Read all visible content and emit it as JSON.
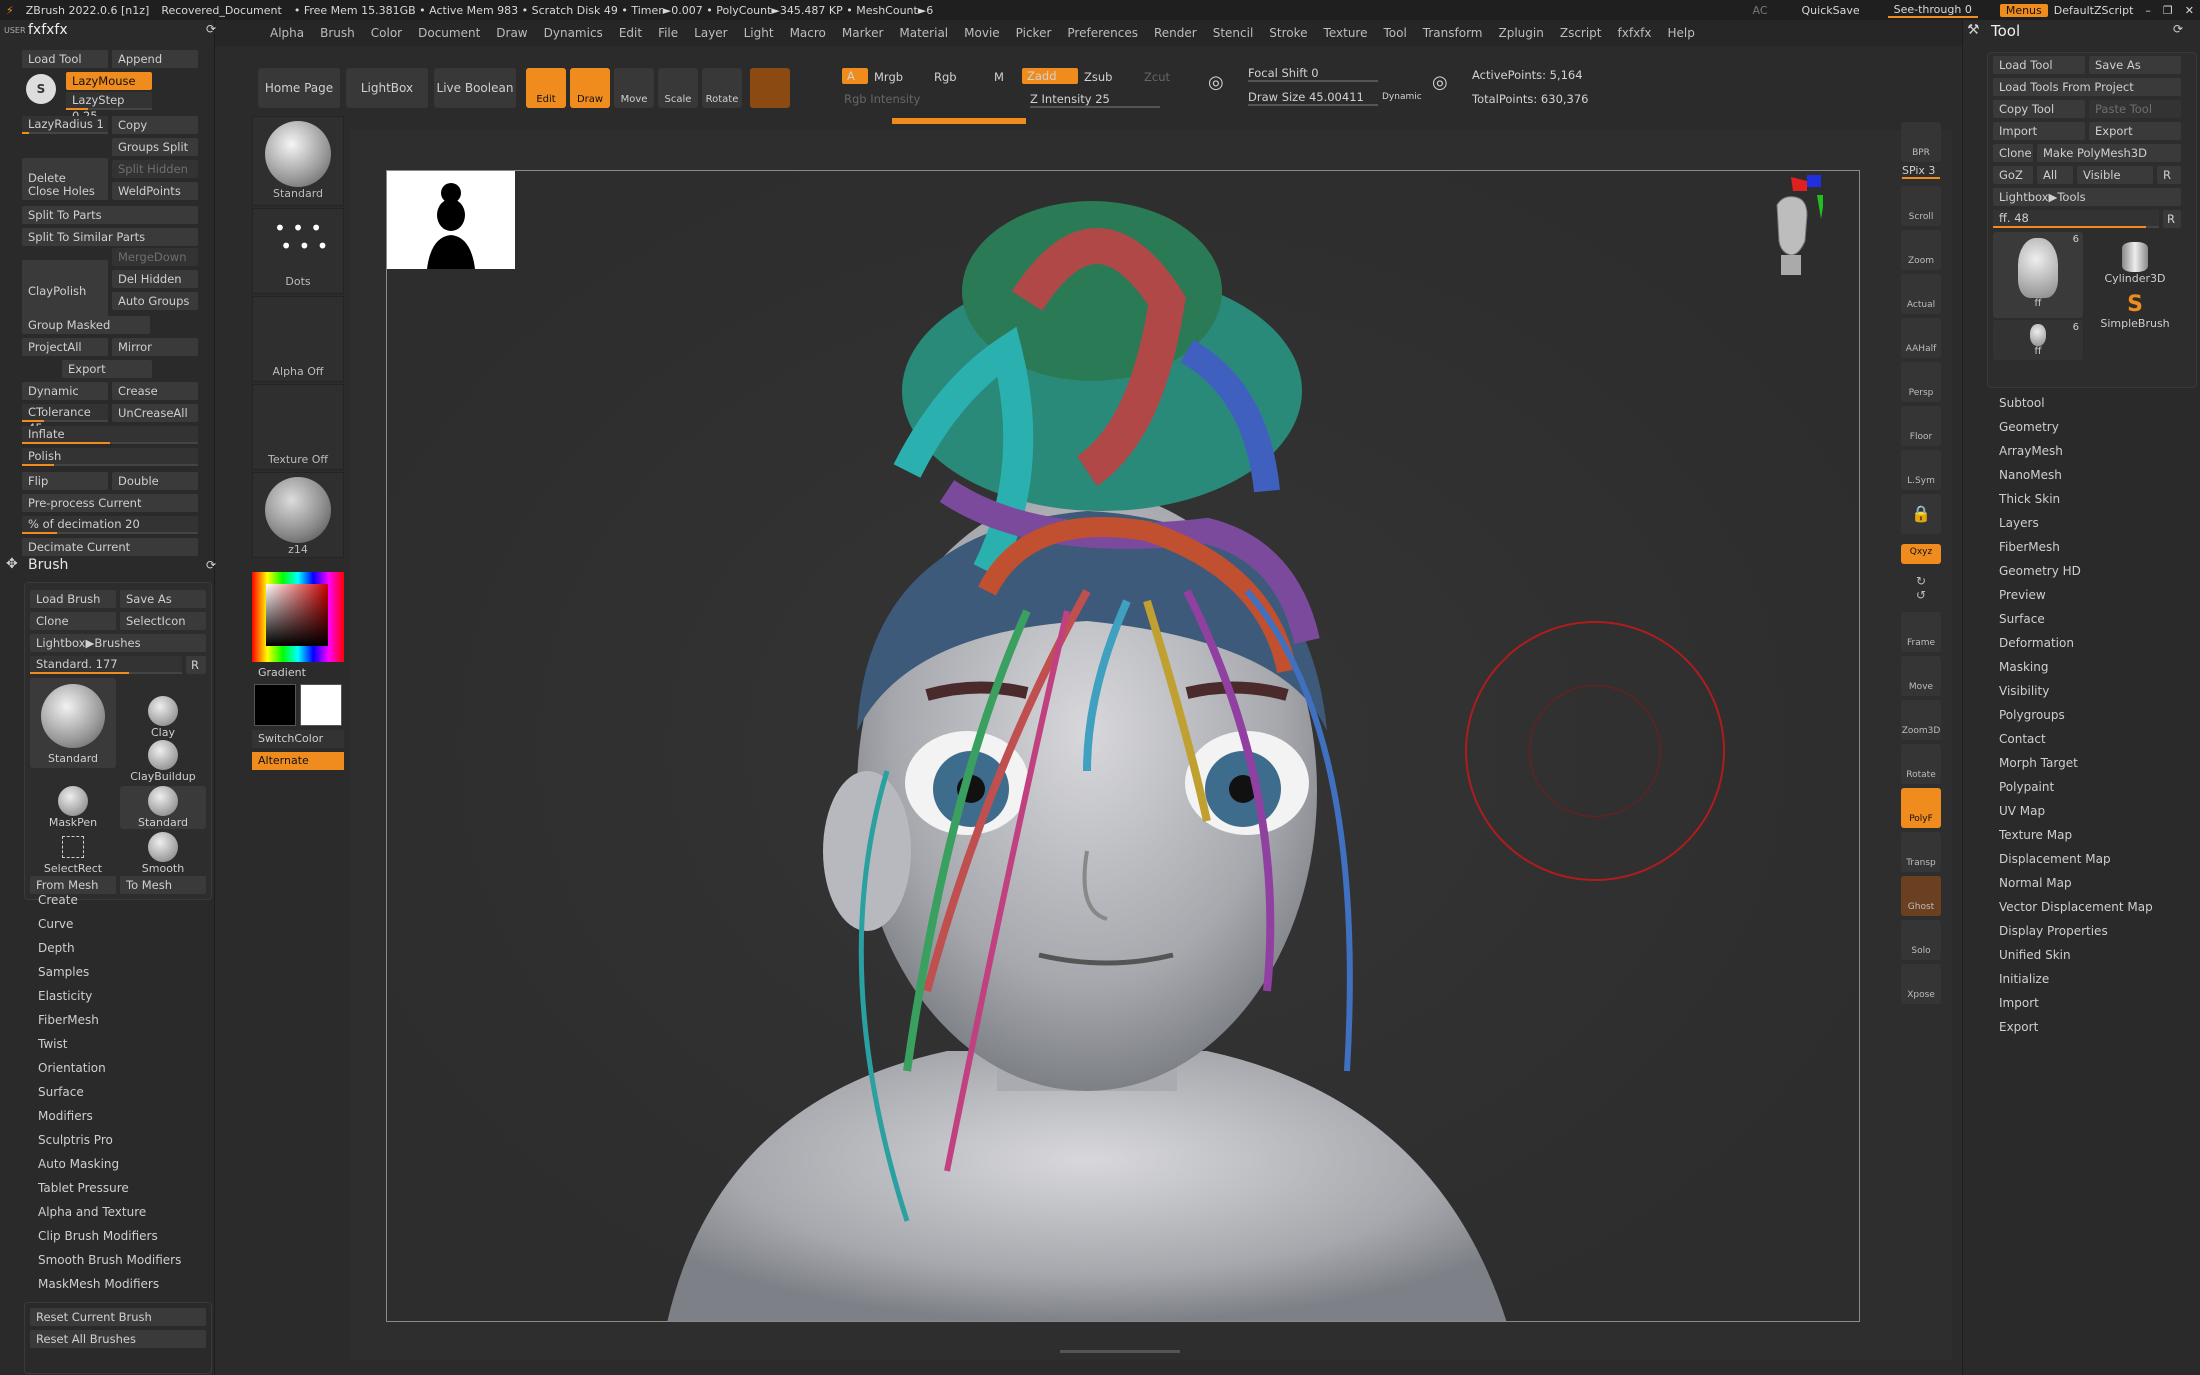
{
  "titlebar": {
    "app": "ZBrush 2022.0.6 [n1z]",
    "document": "Recovered_Document",
    "stats": "• Free Mem 15.381GB • Active Mem 983 • Scratch Disk 49 • Timer►0.007 • PolyCount►345.487 KP • MeshCount►6",
    "ac": "AC",
    "quicksave": "QuickSave",
    "seethrough": "See-through  0",
    "menus": "Menus",
    "defaultzscript": "DefaultZScript"
  },
  "menubar": [
    "Alpha",
    "Brush",
    "Color",
    "Document",
    "Draw",
    "Dynamics",
    "Edit",
    "File",
    "Layer",
    "Light",
    "Macro",
    "Marker",
    "Material",
    "Movie",
    "Picker",
    "Preferences",
    "Render",
    "Stencil",
    "Stroke",
    "Texture",
    "Tool",
    "Transform",
    "Zplugin",
    "Zscript",
    "fxfxfx",
    "Help"
  ],
  "left": {
    "title": "fxfxfx",
    "user": "USER",
    "load_tool": "Load Tool",
    "append": "Append",
    "lazymouse": "LazyMouse",
    "lazystep": "LazyStep 0.25",
    "lazyradius": "LazyRadius 1",
    "copy": "Copy",
    "delete": "Delete",
    "groups_split": "Groups Split",
    "split_hidden": "Split Hidden",
    "close_holes": "Close Holes",
    "weldpoints": "WeldPoints",
    "split_to_parts": "Split To Parts",
    "split_similar": "Split To Similar Parts",
    "claypolish": "ClayPolish",
    "mergedown": "MergeDown",
    "del_hidden": "Del Hidden",
    "auto_groups": "Auto Groups",
    "group_masked": "Group Masked",
    "projectall": "ProjectAll",
    "mirror": "Mirror",
    "export": "Export",
    "dynamic": "Dynamic",
    "crease": "Crease",
    "ctolerance": "CTolerance 45",
    "uncreaseall": "UnCreaseAll",
    "inflate": "Inflate",
    "polish": "Polish",
    "flip": "Flip",
    "double": "Double",
    "preprocess": "Pre-process Current",
    "pct_decimation": "% of decimation 20",
    "decimate": "Decimate Current",
    "brush_title": "Brush",
    "load_brush": "Load Brush",
    "save_as": "Save As",
    "clone": "Clone",
    "selecticon": "SelectIcon",
    "lightbox_brushes": "Lightbox▶Brushes",
    "standard_slider": "Standard. 177",
    "r": "R",
    "brushes": [
      "Clay",
      "ClayBuildup",
      "MaskPen",
      "Standard",
      "SelectRect",
      "Smooth"
    ],
    "standard": "Standard",
    "from_mesh": "From Mesh",
    "to_mesh": "To Mesh",
    "brush_menu": [
      "Create",
      "Curve",
      "Depth",
      "Samples",
      "Elasticity",
      "FiberMesh",
      "Twist",
      "Orientation",
      "Surface",
      "Modifiers",
      "Sculptris Pro",
      "Auto Masking",
      "Tablet Pressure",
      "Alpha and Texture",
      "Clip Brush Modifiers",
      "Smooth Brush Modifiers",
      "MaskMesh Modifiers"
    ],
    "reset_current": "Reset Current Brush",
    "reset_all": "Reset All Brushes"
  },
  "col2": {
    "standard": "Standard",
    "dots": "Dots",
    "alpha_off": "Alpha Off",
    "texture_off": "Texture Off",
    "material": "z14",
    "gradient": "Gradient",
    "switchcolor": "SwitchColor",
    "alternate": "Alternate"
  },
  "toolbar": {
    "home": "Home Page",
    "lightbox": "LightBox",
    "live_boolean": "Live Boolean",
    "edit": "Edit",
    "draw": "Draw",
    "move": "Move",
    "scale": "Scale",
    "rotate": "Rotate",
    "a": "A",
    "mrgb": "Mrgb",
    "rgb": "Rgb",
    "m": "M",
    "zadd": "Zadd",
    "zsub": "Zsub",
    "zcut": "Zcut",
    "rgb_intensity": "Rgb Intensity",
    "z_intensity": "Z Intensity 25",
    "focal_shift": "Focal Shift 0",
    "draw_size": "Draw Size 45.00411",
    "dynamic": "Dynamic",
    "active_points": "ActivePoints: 5,164",
    "total_points": "TotalPoints: 630,376"
  },
  "rshelf": [
    "BPR",
    "SPix 3",
    "Scroll",
    "Zoom",
    "Actual",
    "AAHalf",
    "Persp",
    "Floor",
    "L.Sym",
    "",
    "Qxyz",
    "",
    "",
    "Frame",
    "Move",
    "Zoom3D",
    "Rotate",
    "PolyF",
    "Transp",
    "Ghost",
    "Solo",
    "Xpose"
  ],
  "right": {
    "title": "Tool",
    "load_tool": "Load Tool",
    "save_as": "Save As",
    "load_from_project": "Load Tools From Project",
    "copy_tool": "Copy Tool",
    "paste_tool": "Paste Tool",
    "import": "Import",
    "export": "Export",
    "clone": "Clone",
    "make_polymesh": "Make PolyMesh3D",
    "goz": "GoZ",
    "all": "All",
    "visible": "Visible",
    "r": "R",
    "lightbox_tools": "Lightbox▶Tools",
    "ff_slider": "ff. 48",
    "tool_thumbs": [
      {
        "label": "ff",
        "count": "6"
      },
      {
        "label": "Cylinder3D",
        "count": ""
      },
      {
        "label": "SimpleBrush",
        "count": ""
      },
      {
        "label": "ff",
        "count": "6"
      }
    ],
    "menu": [
      "Subtool",
      "Geometry",
      "ArrayMesh",
      "NanoMesh",
      "Thick Skin",
      "Layers",
      "FiberMesh",
      "Geometry HD",
      "Preview",
      "Surface",
      "Deformation",
      "Masking",
      "Visibility",
      "Polygroups",
      "Contact",
      "Morph Target",
      "Polypaint",
      "UV Map",
      "Texture Map",
      "Displacement Map",
      "Normal Map",
      "Vector Displacement Map",
      "Display Properties",
      "Unified Skin",
      "Initialize",
      "Import",
      "Export"
    ]
  },
  "colors": {
    "accent": "#f08c1e",
    "panel": "#2a2a2a",
    "brush_circle": "#b01c1c"
  }
}
